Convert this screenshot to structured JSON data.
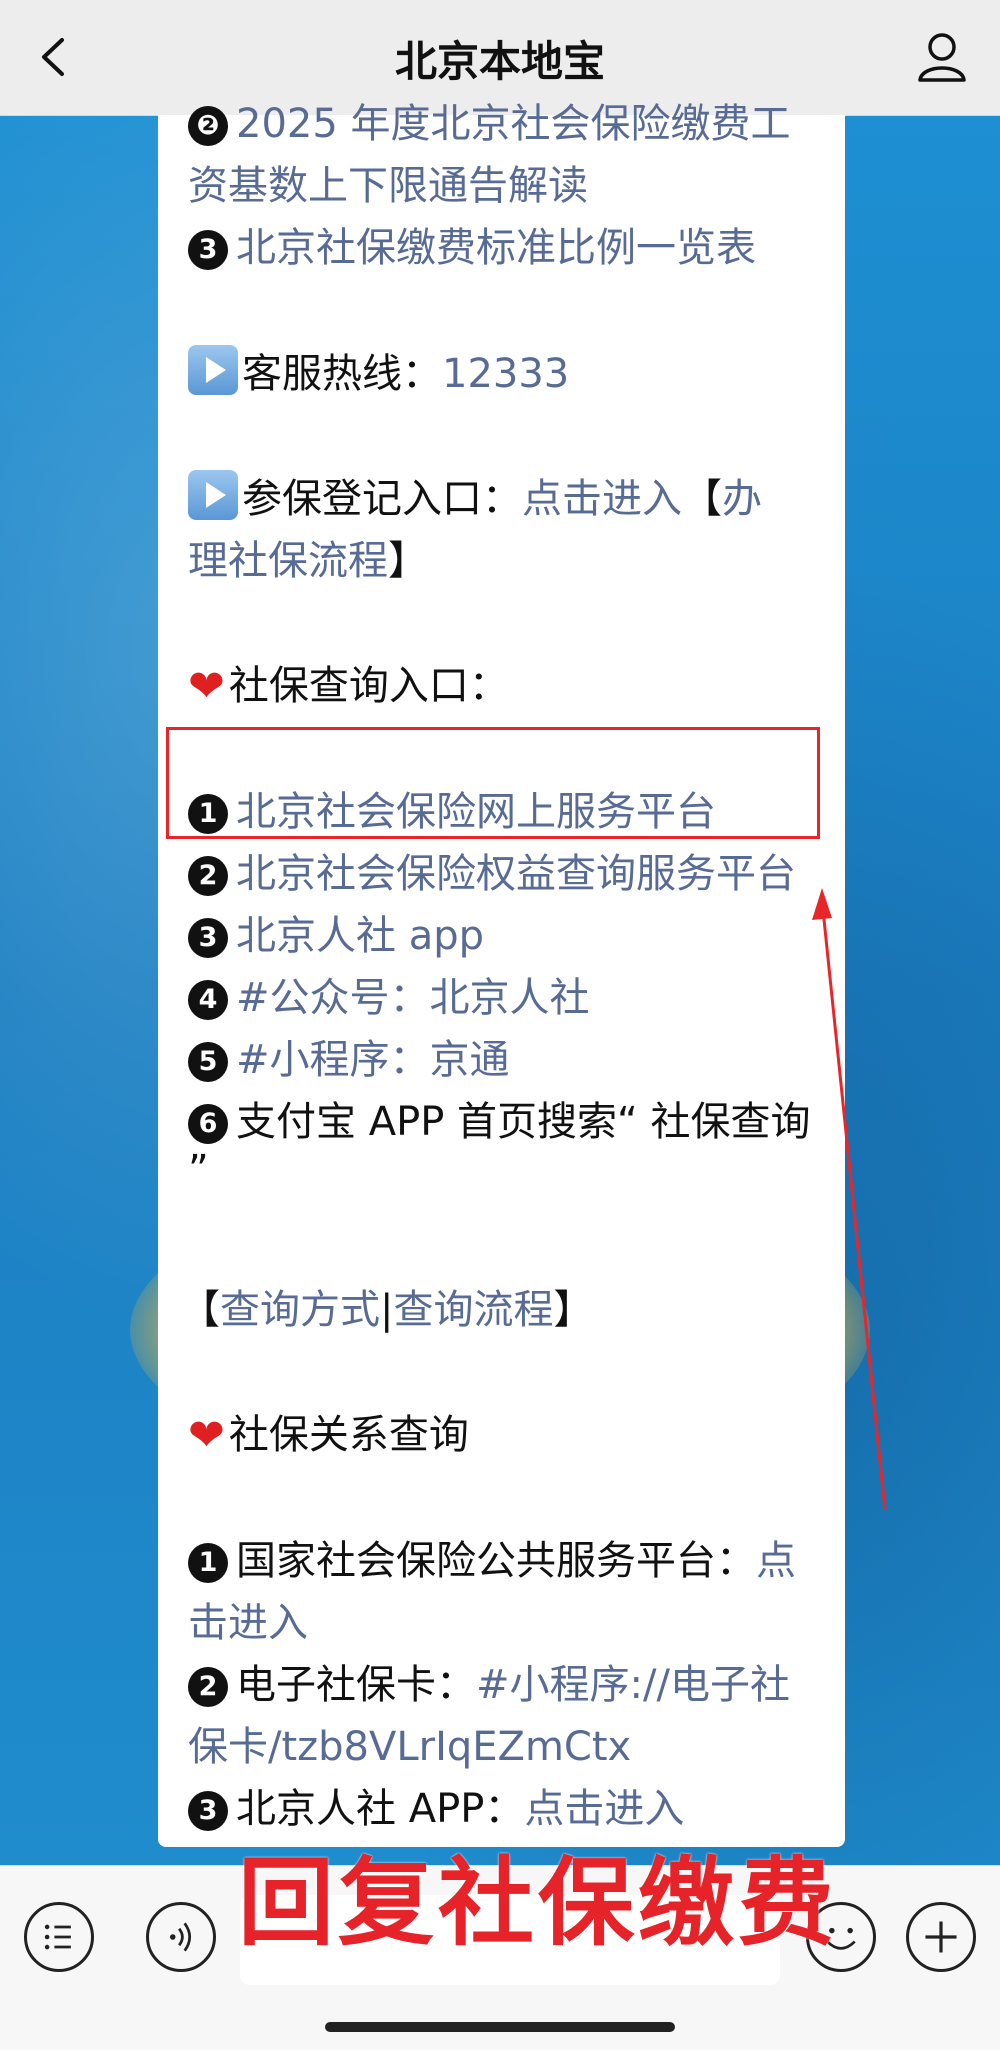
{
  "header": {
    "title": "北京本地宝"
  },
  "icons": {
    "back": "chevron-left-icon",
    "profile": "person-icon"
  },
  "card": {
    "line0": {
      "num": "❷",
      "text": "2025 年度北京社会保险缴费工"
    },
    "line1": {
      "text": "资基数上下限通告解读"
    },
    "line2": {
      "num": "3",
      "text": "北京社保缴费标准比例一览表"
    },
    "hotline": {
      "label": "客服热线：",
      "value": "12333"
    },
    "register": {
      "label": "参保登记入口：",
      "link": "点击进入",
      "bracket_open": "【",
      "link2a": "办",
      "link2b": "理社保流程",
      "bracket_close": "】"
    },
    "query_heading": "社保查询入口：",
    "query_items": [
      {
        "num": "1",
        "text": "北京社会保险网上服务平台"
      },
      {
        "num": "2",
        "text": "北京社会保险权益查询服务平台"
      },
      {
        "num": "3",
        "text": "北京人社 app"
      },
      {
        "num": "4",
        "label": "#公众号：",
        "text": "北京人社"
      },
      {
        "num": "5",
        "label": "#小程序：",
        "text": "京通"
      },
      {
        "num": "6",
        "text": "支付宝 APP 首页搜索“ 社保查询",
        "text_cont": "”"
      }
    ],
    "query_methods": {
      "open": "【",
      "a": "查询方式",
      "sep": "|",
      "b": "查询流程",
      "close": "】"
    },
    "relation_heading": "社保关系查询",
    "relation_items": [
      {
        "num": "1",
        "label": "国家社会保险公共服务平台：",
        "link_a": "点",
        "link_b": "击进入"
      },
      {
        "num": "2",
        "label": "电子社保卡：",
        "link_a": "#小程序://电子社",
        "link_b": "保卡/tzb8VLrIqEZmCtx"
      },
      {
        "num": "3",
        "label": "北京人社 APP：",
        "link_a": "点击进入"
      }
    ]
  },
  "promo_text": "回复社保缴费",
  "toolbar": {
    "menu": "list-icon",
    "voice": "voice-icon",
    "emoji": "emoji-icon",
    "add": "plus-icon"
  },
  "colors": {
    "link": "#576b95",
    "highlight": "#e8262a",
    "background": "#1f86c8"
  }
}
